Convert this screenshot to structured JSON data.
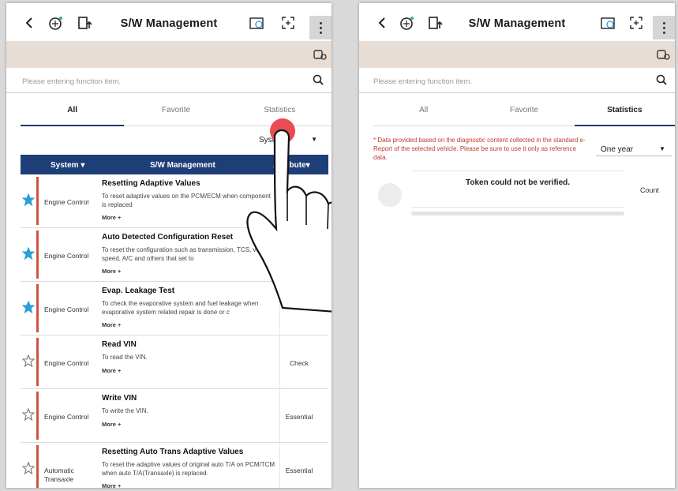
{
  "left_screen": {
    "title": "S/W Management",
    "search_placeholder": "Please entering function item.",
    "tabs": [
      {
        "label": "All",
        "active": true
      },
      {
        "label": "Favorite",
        "active": false
      },
      {
        "label": "Statistics",
        "active": false
      }
    ],
    "system_filter": "System",
    "table_headers": {
      "system": "System",
      "sw": "S/W Management",
      "attribute": "Attribute"
    },
    "more_label": "More +",
    "rows": [
      {
        "favorite": true,
        "system": "Engine Control",
        "name": "Resetting Adaptive Values",
        "desc": "To reset adaptive values on the PCM/ECM when component is replaced",
        "attribute": ""
      },
      {
        "favorite": true,
        "system": "Engine Control",
        "name": "Auto Detected Configuration Reset",
        "desc": "To reset the configuration such as transmission, TCS, vehicle speed, A/C and others that set to",
        "attribute": ""
      },
      {
        "favorite": true,
        "system": "Engine Control",
        "name": "Evap. Leakage Test",
        "desc": "To check the evaporative system and fuel leakage when evaporative system related repair is done or c",
        "attribute": ""
      },
      {
        "favorite": false,
        "system": "Engine Control",
        "name": "Read VIN",
        "desc": "To read the VIN.",
        "attribute": "Check"
      },
      {
        "favorite": false,
        "system": "Engine Control",
        "name": "Write VIN",
        "desc": "To write the VIN.",
        "attribute": "Essential"
      },
      {
        "favorite": false,
        "system": "Automatic Transaxle",
        "name": "Resetting Auto Trans Adaptive Values",
        "desc": "To reset the adaptive values of original auto T/A on PCM/TCM when auto T/A(Transaxle) is replaced.",
        "attribute": "Essential"
      }
    ]
  },
  "right_screen": {
    "title": "S/W Management",
    "search_placeholder": "Please entering function item.",
    "tabs": [
      {
        "label": "All",
        "active": false
      },
      {
        "label": "Favorite",
        "active": false
      },
      {
        "label": "Statistics",
        "active": true
      }
    ],
    "note": "* Data provided based on the diagnostic content collected in the standard e-Report of the selected vehicle. Please be sure to use it only as reference data.",
    "period": "One year",
    "token_message": "Token could not be verified.",
    "count_label": "Count"
  },
  "colors": {
    "header_navy": "#1e3e78",
    "accent_red": "#d0533f",
    "star_blue": "#2a9fd6",
    "band_beige": "#e8ddd5",
    "touch_red": "#e8424a"
  },
  "icons": [
    "back-icon",
    "vehicle-scan-icon",
    "sw-update-icon",
    "ecu-icon",
    "screen-capture-icon",
    "more-vert-icon",
    "vehicle-icon",
    "search-icon",
    "star-icon",
    "dropdown-arrow-icon"
  ]
}
